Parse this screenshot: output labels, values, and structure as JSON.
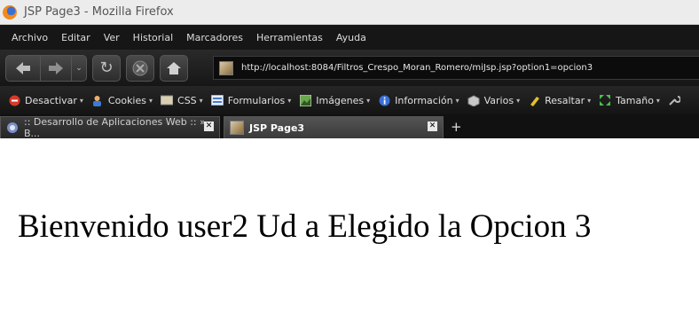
{
  "window": {
    "title": "JSP Page3 - Mozilla Firefox"
  },
  "menu": [
    "Archivo",
    "Editar",
    "Ver",
    "Historial",
    "Marcadores",
    "Herramientas",
    "Ayuda"
  ],
  "address": {
    "url": "http://localhost:8084/Filtros_Crespo_Moran_Romero/miJsp.jsp?option1=opcion3"
  },
  "webdev_toolbar": {
    "items": [
      {
        "label": "Desactivar",
        "icon": "block-icon"
      },
      {
        "label": "Cookies",
        "icon": "cookie-icon"
      },
      {
        "label": "CSS",
        "icon": "css-icon"
      },
      {
        "label": "Formularios",
        "icon": "form-icon"
      },
      {
        "label": "Imágenes",
        "icon": "image-icon"
      },
      {
        "label": "Información",
        "icon": "info-icon"
      },
      {
        "label": "Varios",
        "icon": "misc-icon"
      },
      {
        "label": "Resaltar",
        "icon": "highlight-icon"
      },
      {
        "label": "Tamaño",
        "icon": "resize-icon"
      }
    ]
  },
  "tabs": [
    {
      "label": ":: Desarrollo de Aplicaciones Web :: » B...",
      "active": false
    },
    {
      "label": "JSP Page3",
      "active": true
    }
  ],
  "page": {
    "message": "Bienvenido user2 Ud a Elegido la Opcion 3"
  }
}
